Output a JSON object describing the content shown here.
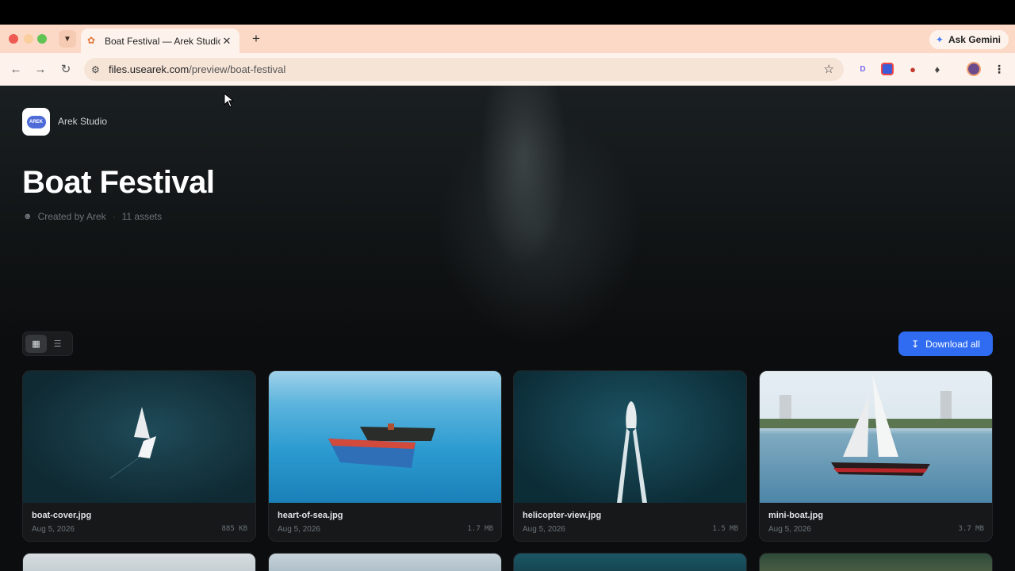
{
  "browser": {
    "tab_title": "Boat Festival — Arek Studio",
    "url_host": "files.usearek.com",
    "url_path": "/preview/boat-festival",
    "gemini_label": "Ask Gemini"
  },
  "brand": {
    "studio_name": "Arek Studio",
    "logo_text": "AREK"
  },
  "collection": {
    "title": "Boat Festival",
    "created_by": "Created by Arek",
    "asset_count": "11 assets"
  },
  "actions": {
    "download_all": "Download all"
  },
  "assets": [
    {
      "name": "boat-cover.jpg",
      "date": "Aug 5, 2026",
      "size": "885 KB"
    },
    {
      "name": "heart-of-sea.jpg",
      "date": "Aug 5, 2026",
      "size": "1.7 MB"
    },
    {
      "name": "helicopter-view.jpg",
      "date": "Aug 5, 2026",
      "size": "1.5 MB"
    },
    {
      "name": "mini-boat.jpg",
      "date": "Aug 5, 2026",
      "size": "3.7 MB"
    }
  ],
  "colors": {
    "accent": "#2f6cf1",
    "tabstrip": "#fcd9c6",
    "page_bg": "#0c0d0e"
  },
  "icons": [
    "tabs-menu-icon",
    "close-icon",
    "plus-icon",
    "gemini-icon",
    "back-icon",
    "forward-icon",
    "reload-icon",
    "site-info-icon",
    "star-icon",
    "extension-icon",
    "profile-icon",
    "menu-icon",
    "user-icon",
    "grid-view-icon",
    "list-view-icon",
    "download-icon"
  ]
}
